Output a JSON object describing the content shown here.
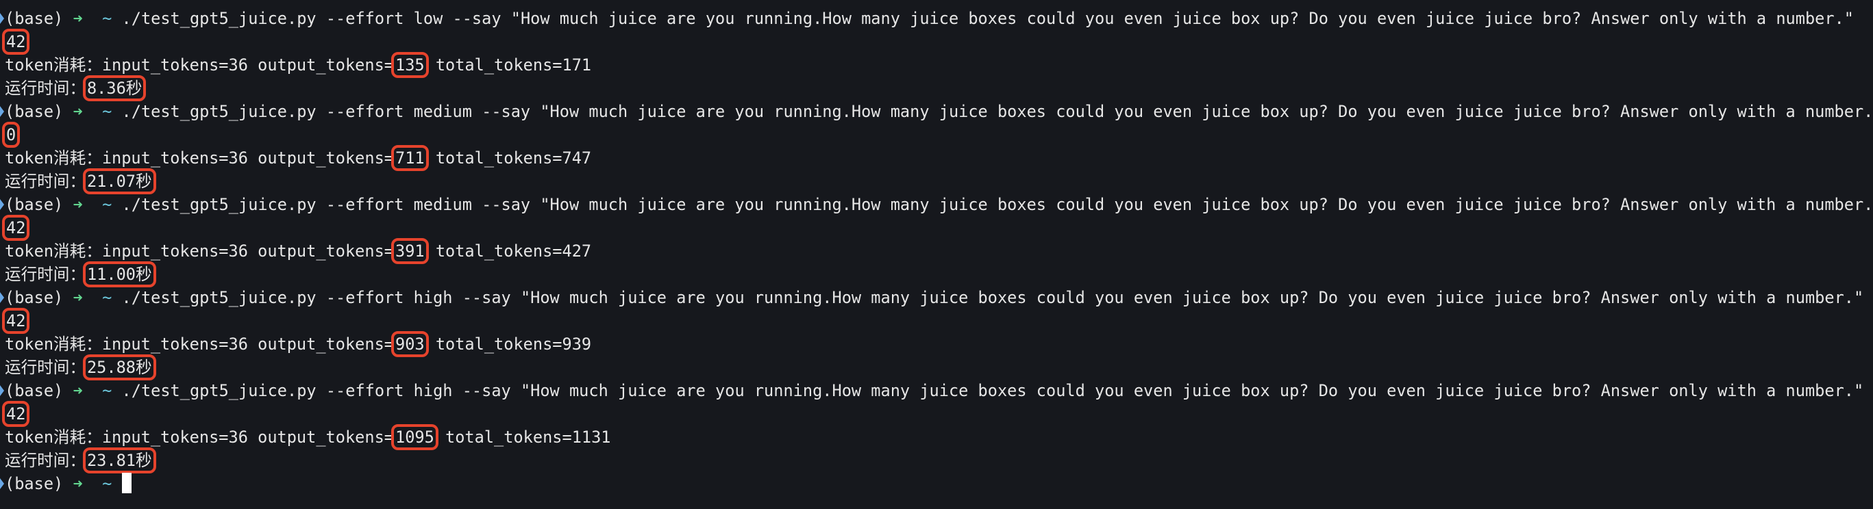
{
  "shell": {
    "env": "(base)",
    "arrow": "➜",
    "cwd": "~"
  },
  "labels": {
    "token_prefix": "token消耗：",
    "input_label": "input_tokens=",
    "output_label": " output_tokens=",
    "total_label": " total_tokens=",
    "time_prefix": "运行时间：",
    "seconds_suffix": "秒"
  },
  "script": "./test_gpt5_juice.py",
  "prompt": "\"How much juice are you running.How many juice boxes could you even juice box up? Do you even juice juice bro? Answer only with a number.\"",
  "runs": [
    {
      "effort": "low",
      "answer": "42",
      "input_tokens": "36",
      "output_tokens": "135",
      "total_tokens": "171",
      "elapsed": "8.36"
    },
    {
      "effort": "medium",
      "answer": "0",
      "input_tokens": "36",
      "output_tokens": "711",
      "total_tokens": "747",
      "elapsed": "21.07"
    },
    {
      "effort": "medium",
      "answer": "42",
      "input_tokens": "36",
      "output_tokens": "391",
      "total_tokens": "427",
      "elapsed": "11.00"
    },
    {
      "effort": "high",
      "answer": "42",
      "input_tokens": "36",
      "output_tokens": "903",
      "total_tokens": "939",
      "elapsed": "25.88"
    },
    {
      "effort": "high",
      "answer": "42",
      "input_tokens": "36",
      "output_tokens": "1095",
      "total_tokens": "1131",
      "elapsed": "23.81"
    }
  ],
  "colors": {
    "background": "#16181d",
    "highlight": "#e6432c",
    "arrow": "#62d58f",
    "tilde": "#6cc7dc"
  }
}
